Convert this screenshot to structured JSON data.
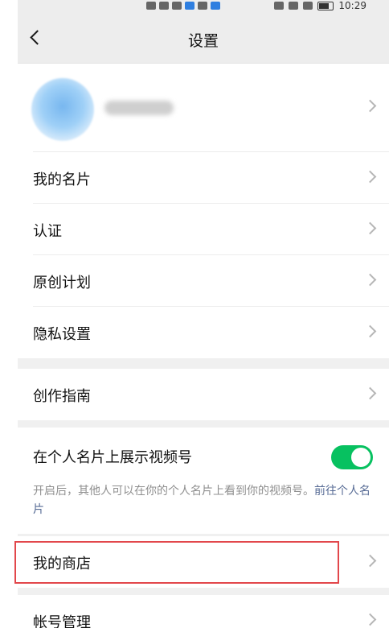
{
  "status_bar": {
    "left_icons": [
      "HD-icon",
      "signal-icon",
      "wifi-icon",
      "notification-icon",
      "bell-icon",
      "app-icon"
    ],
    "right_icons": [
      "alarm-icon",
      "bluetooth-icon",
      "mute-icon",
      "battery-icon"
    ],
    "time": "10:29"
  },
  "navbar": {
    "title": "设置"
  },
  "profile": {
    "name": ""
  },
  "group1": {
    "items": [
      {
        "label": "我的名片"
      },
      {
        "label": "认证"
      },
      {
        "label": "原创计划"
      },
      {
        "label": "隐私设置"
      }
    ]
  },
  "group2": {
    "label": "创作指南"
  },
  "video_section": {
    "label": "在个人名片上展示视频号",
    "toggle_on": true,
    "desc_text": "开启后，其他人可以在你的个人名片上看到你的视频号。",
    "desc_link": "前往个人名片"
  },
  "store": {
    "label": "我的商店"
  },
  "account": {
    "label": "帐号管理"
  },
  "colors": {
    "toggle_on": "#07c160",
    "highlight_border": "#e2474b",
    "link": "#576b95"
  }
}
